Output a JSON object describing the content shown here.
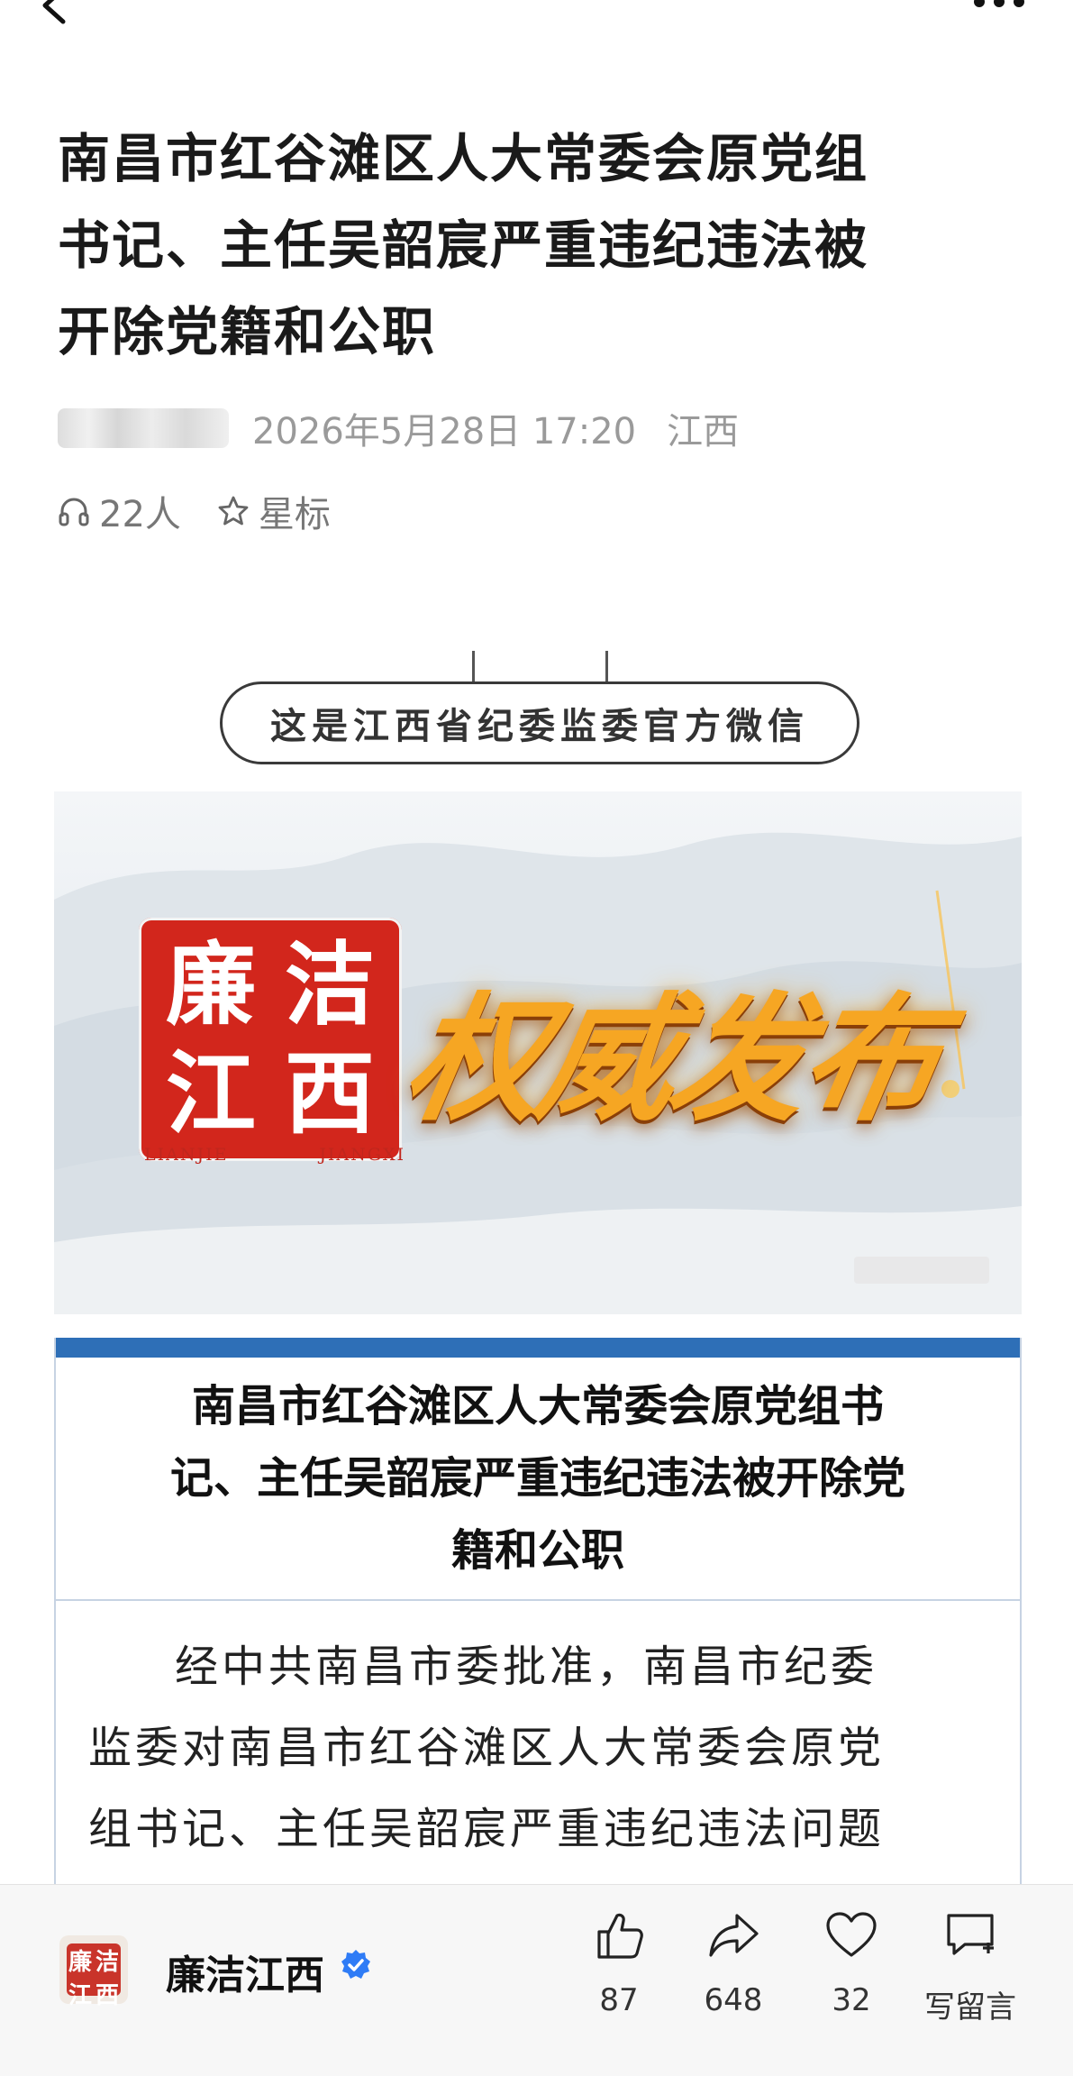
{
  "topbar": {
    "back_icon": "chevron-left-icon",
    "more_icon": "more-dots-icon"
  },
  "article": {
    "title": "南昌市红谷滩区人大常委会原党组书记、主任吴韶宸严重违纪违法被开除党籍和公职",
    "title_lines": [
      "南昌市红谷滩区人大常委会原党组",
      "书记、主任吴韶宸严重违纪违法被",
      "开除党籍和公职"
    ],
    "date": "2026年5月28日 17:20",
    "location": "江西",
    "listeners": "22人",
    "star_label": "星标"
  },
  "intro_pill": "这是江西省纪委监委官方微信",
  "banner": {
    "seal_chars": [
      "廉",
      "洁",
      "江",
      "西"
    ],
    "seal_sub_left": "LIANJIE",
    "seal_sub_right": "JIANGXI",
    "headline": "权威发布"
  },
  "card": {
    "title_lines": [
      "南昌市红谷滩区人大常委会原党组书",
      "记、主任吴韶宸严重违纪违法被开除党",
      "籍和公职"
    ],
    "body_lines": [
      "经中共南昌市委批准，南昌市纪委",
      "监委对南昌市红谷滩区人大常委会原党",
      "组书记、主任吴韶宸严重违纪违法问题"
    ]
  },
  "bottombar": {
    "account_name": "廉洁江西",
    "avatar_chars": [
      "廉",
      "洁",
      "江",
      "西"
    ],
    "actions": [
      {
        "icon": "thumbs-up-icon",
        "label": "87"
      },
      {
        "icon": "share-icon",
        "label": "648"
      },
      {
        "icon": "heart-icon",
        "label": "32"
      },
      {
        "icon": "comment-plus-icon",
        "label": "写留言"
      }
    ]
  },
  "colors": {
    "seal_red": "#d2261c",
    "card_blue": "#2e6fb7",
    "verified_blue": "#2f7cf6",
    "headline_gold": "#f6a623"
  }
}
